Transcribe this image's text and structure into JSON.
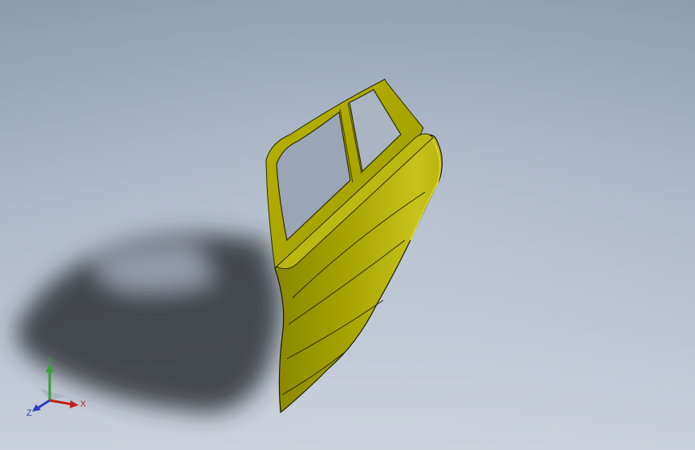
{
  "viewport": {
    "background_top": "#8b9bb0",
    "background_bottom": "#c9d0db"
  },
  "model": {
    "part": "car-rear-door",
    "body_color": "#a8a400",
    "highlight_color": "#c7c21a",
    "shadow_color": "#2b2d32",
    "edge_color": "#1a1a00"
  },
  "triad": {
    "x_label": "X",
    "y_label": "Y",
    "z_label": "Z",
    "x_color": "#c0201a",
    "y_color": "#2fa52a",
    "z_color": "#2a3fc0"
  }
}
